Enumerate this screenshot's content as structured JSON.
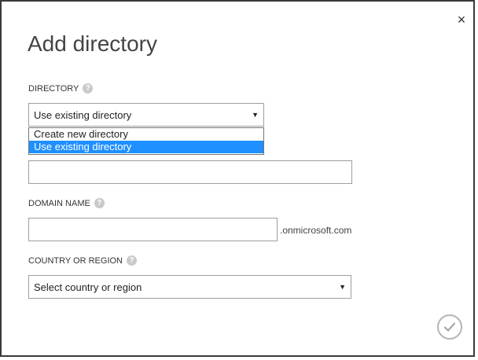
{
  "dialog": {
    "title": "Add directory",
    "close_glyph": "×"
  },
  "directory": {
    "label": "DIRECTORY",
    "help_glyph": "?",
    "selected_value": "Use existing directory",
    "caret_glyph": "▼",
    "options": [
      {
        "label": "Create new directory",
        "selected": false
      },
      {
        "label": "Use existing directory",
        "selected": true
      }
    ]
  },
  "hidden_field": {
    "value": ""
  },
  "domain": {
    "label": "DOMAIN NAME",
    "help_glyph": "?",
    "value": "",
    "suffix": ".onmicrosoft.com"
  },
  "country": {
    "label": "COUNTRY OR REGION",
    "help_glyph": "?",
    "selected_value": "Select country or region",
    "caret_glyph": "▼"
  },
  "icons": {
    "close": "close-icon",
    "help": "help-icon",
    "caret": "chevron-down-icon",
    "confirm": "checkmark-icon"
  },
  "colors": {
    "selected_option_bg": "#1e90ff",
    "help_circle": "#c9c9c9",
    "confirm_circle": "#b5b5b5"
  }
}
